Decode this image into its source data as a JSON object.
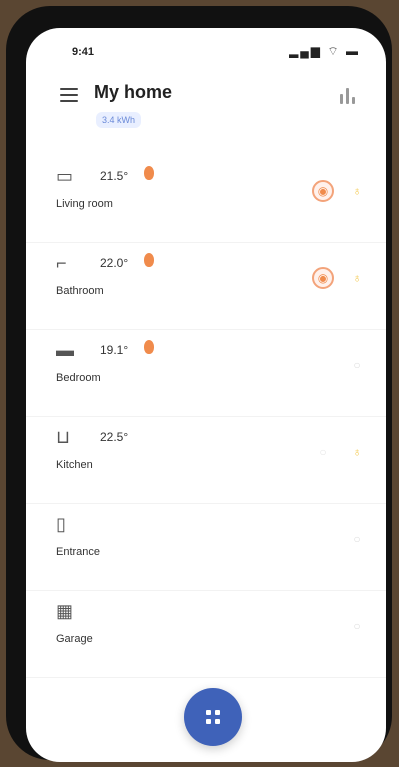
{
  "status": {
    "time": "9:41",
    "icons": "▂▄▆ ⌔ ▬"
  },
  "header": {
    "title": "My home",
    "badge": "3.4 kWh"
  },
  "rooms": [
    {
      "name": "Living room",
      "temp": "21.5°",
      "icon": "sofa-icon",
      "heating": true,
      "actions": [
        "heat",
        "light"
      ]
    },
    {
      "name": "Bathroom",
      "temp": "22.0°",
      "icon": "bath-icon",
      "heating": true,
      "actions": [
        "heat",
        "light"
      ]
    },
    {
      "name": "Bedroom",
      "temp": "19.1°",
      "icon": "bed-icon",
      "heating": true,
      "actions": [
        "muted"
      ]
    },
    {
      "name": "Kitchen",
      "temp": "22.5°",
      "icon": "pot-icon",
      "heating": false,
      "actions": [
        "muted2",
        "light"
      ]
    },
    {
      "name": "Entrance",
      "temp": "",
      "icon": "door-icon",
      "heating": false,
      "actions": [
        "muted"
      ]
    },
    {
      "name": "Garage",
      "temp": "",
      "icon": "garage-icon",
      "heating": false,
      "actions": [
        "muted"
      ]
    }
  ],
  "colors": {
    "accent": "#3f62b9",
    "heat": "#f08b4c",
    "light": "#f3c94f"
  }
}
